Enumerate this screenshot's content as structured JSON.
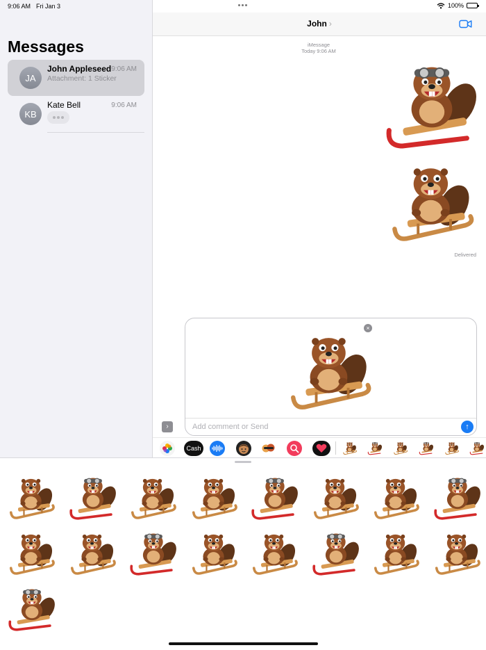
{
  "status_bar": {
    "time": "9:06 AM",
    "date": "Fri Jan 3",
    "battery": "100%"
  },
  "sidebar": {
    "title": "Messages",
    "conversations": [
      {
        "initials": "JA",
        "name": "John Appleseed",
        "time": "9:06 AM",
        "preview": "Attachment: 1 Sticker",
        "selected": true
      },
      {
        "initials": "KB",
        "name": "Kate Bell",
        "time": "9:06 AM",
        "preview": "",
        "typing": true
      }
    ]
  },
  "conversation": {
    "contact": "John",
    "chevron": "›",
    "service": "iMessage",
    "timestamp": "Today 9:06 AM",
    "status": "Delivered",
    "messages": [
      {
        "type": "sticker",
        "icon": "beaver-sled-sticker",
        "variant": "goggles-red-sled"
      },
      {
        "type": "sticker",
        "icon": "beaver-sled-sticker",
        "variant": "happy-wooden-sled"
      }
    ]
  },
  "compose": {
    "placeholder": "Add comment or Send",
    "value": "",
    "attachment": {
      "icon": "beaver-sled-sticker",
      "remove_icon": "close-icon",
      "remove_glyph": "×"
    },
    "send_glyph": "↑",
    "expand_glyph": "›"
  },
  "app_bar": {
    "apps": [
      {
        "name": "photos",
        "icon": "photos-icon"
      },
      {
        "name": "apple-cash",
        "label": "Cash",
        "icon": "apple-cash-icon"
      },
      {
        "name": "audio",
        "icon": "audio-waveform-icon"
      },
      {
        "name": "memoji",
        "icon": "memoji-icon"
      },
      {
        "name": "memoji-stickers",
        "icon": "memoji-stickers-icon"
      },
      {
        "name": "images-search",
        "icon": "images-search-icon"
      },
      {
        "name": "digital-touch",
        "icon": "digital-touch-icon"
      },
      {
        "name": "beaver-stickers-1",
        "icon": "beaver-sticker-icon"
      },
      {
        "name": "beaver-stickers-2",
        "icon": "beaver-sticker-icon"
      },
      {
        "name": "beaver-stickers-3",
        "icon": "beaver-sticker-icon"
      },
      {
        "name": "beaver-stickers-4",
        "icon": "beaver-sticker-icon"
      },
      {
        "name": "beaver-stickers-5",
        "icon": "beaver-sticker-icon"
      },
      {
        "name": "beaver-stickers-6",
        "icon": "beaver-sticker-icon"
      }
    ]
  },
  "sticker_drawer": {
    "sticker_count": 17,
    "icon": "beaver-sled-sticker"
  },
  "colors": {
    "accent": "#1a7cf5",
    "beaver_fur": "#8a4a22",
    "beaver_belly": "#e2b078",
    "sled_red": "#d32a2a",
    "sled_wood": "#c98a45",
    "sidebar_bg": "#f2f2f7",
    "selected_row": "#d1d1d6"
  }
}
